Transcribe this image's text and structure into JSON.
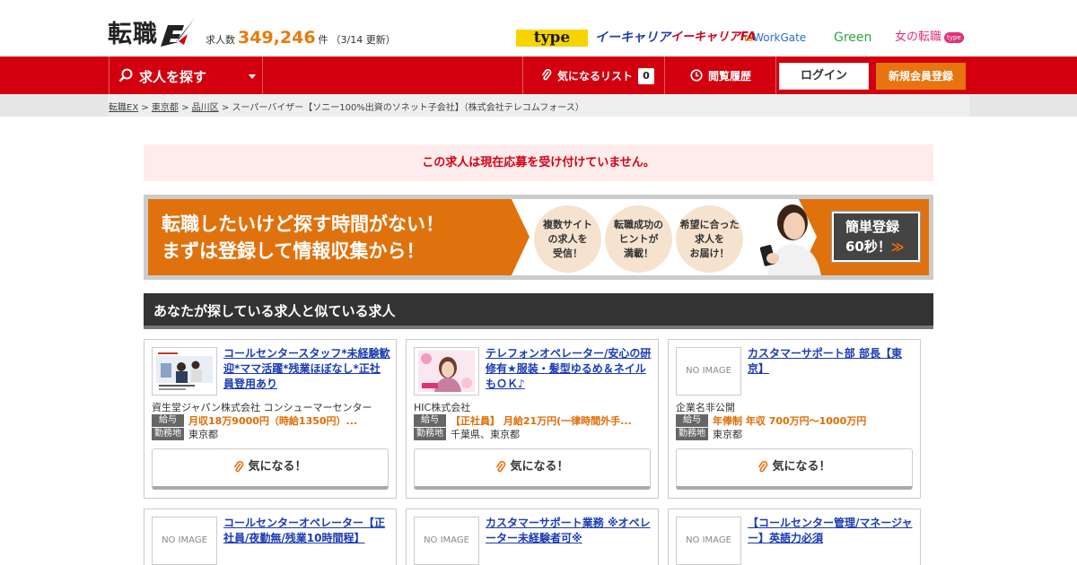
{
  "header": {
    "logo_text": "転職",
    "logo_ex": "EX",
    "count_prefix": "求人数",
    "count_value": "349,246",
    "count_unit": "件",
    "count_update": "（3/14 更新）",
    "brands": {
      "type": "type",
      "career": "イーキャリア",
      "career_fa": "イーキャリアFA",
      "workgate": "WorkGate",
      "green": "Green",
      "onna": "女の転職",
      "onna_pill": "type"
    }
  },
  "nav": {
    "search_label": "求人を探す",
    "favorites_label": "気になるリスト",
    "favorites_count": "0",
    "history_label": "閲覧履歴",
    "login_label": "ログイン",
    "register_label": "新規会員登録"
  },
  "breadcrumb": {
    "home": "転職EX",
    "sep": " > ",
    "pref": "東京都",
    "city": "品川区",
    "current": "スーパーバイザー【ソニー100%出資のソネット子会社】（株式会社テレコムフォース）"
  },
  "notice": "この求人は現在応募を受け付けていません。",
  "banner": {
    "line1": "転職したいけど探す時間がない！",
    "line2": "まずは登録して情報収集から！",
    "circles": [
      "複数サイト\nの求人を\n受信！",
      "転職成功の\nヒントが\n満載！",
      "希望に合った\n求人を\nお届け！"
    ],
    "cta_line1": "簡単登録",
    "cta_line2": "60秒！",
    "cta_arrow": "≫"
  },
  "similar": {
    "heading": "あなたが探している求人と似ている求人",
    "salary_tag": "給与",
    "location_tag": "勤務地",
    "fav_label": "気になる！",
    "no_image": "NO IMAGE",
    "jobs": [
      {
        "title": "コールセンタースタッフ*未経験歓迎*ママ活躍*残業ほぼなし*正社員登用あり",
        "company": "資生堂ジャパン株式会社 コンシューマーセンター",
        "salary": "月収18万9000円（時給1350円）...",
        "location": "東京都",
        "image": "photo-office"
      },
      {
        "title": "テレフォンオペレーター/安心の研修有★服装・髪型ゆるめ＆ネイルもＯＫ♪",
        "company": "HIC株式会社",
        "salary": "【正社員】 月給21万円(一律時間外手...",
        "location": "千葉県、東京都",
        "image": "photo-woman"
      },
      {
        "title": "カスタマーサポート部 部長【東京】",
        "company": "企業名非公開",
        "salary": "年俸制 年収 700万円〜1000万円",
        "location": "東京都",
        "image": "none"
      },
      {
        "title": "コールセンターオペレーター【正社員/夜勤無/残業10時間程】",
        "image": "none"
      },
      {
        "title": "カスタマーサポート業務 ※オペレーター未経験者可※",
        "image": "none"
      },
      {
        "title": "【コールセンター管理/マネージャー】英語力必須",
        "image": "none"
      }
    ]
  },
  "colors": {
    "brand_red": "#d2000f",
    "accent_orange": "#e8730f",
    "link_blue": "#1a3bb3",
    "salary_orange": "#e06b00",
    "notice_bg": "#fdecec"
  }
}
